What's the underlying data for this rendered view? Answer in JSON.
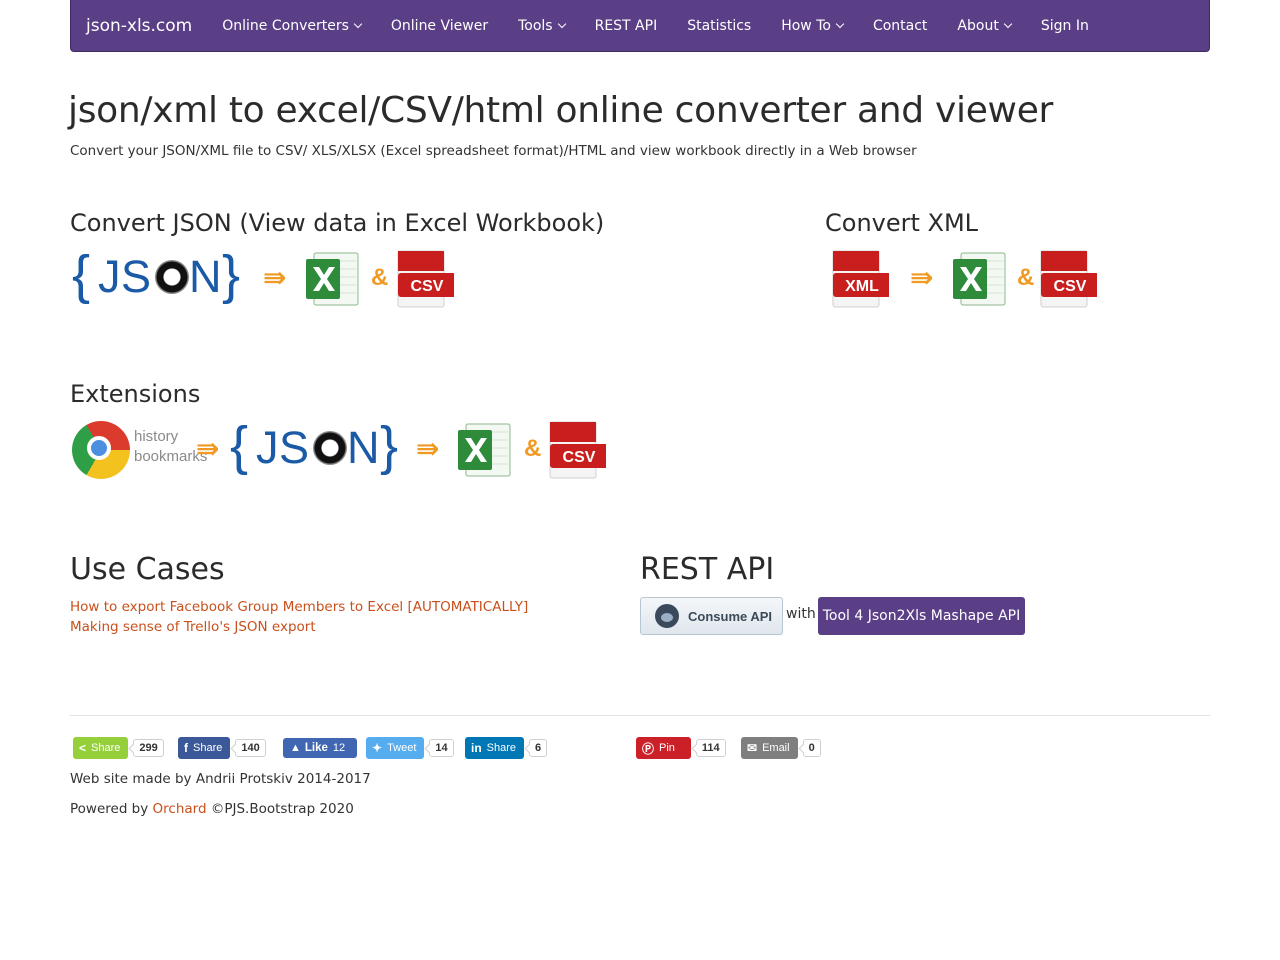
{
  "navbar": {
    "brand": "json-xls.com",
    "items": [
      {
        "label": "Online Converters",
        "dropdown": true
      },
      {
        "label": "Online Viewer",
        "dropdown": false
      },
      {
        "label": "Tools",
        "dropdown": true
      },
      {
        "label": "REST API",
        "dropdown": false
      },
      {
        "label": "Statistics",
        "dropdown": false
      },
      {
        "label": "How To",
        "dropdown": true
      },
      {
        "label": "Contact",
        "dropdown": false
      },
      {
        "label": "About",
        "dropdown": true
      },
      {
        "label": "Sign In",
        "dropdown": false
      }
    ]
  },
  "header": {
    "title": "json/xml to excel/CSV/html online converter and viewer",
    "subtitle": "Convert your JSON/XML file to CSV/ XLS/XLSX (Excel spreadsheet format)/HTML and view workbook directly in a Web browser"
  },
  "sections": {
    "convert_json": "Convert JSON (View data in Excel Workbook)",
    "convert_xml": "Convert XML",
    "extensions": "Extensions",
    "use_cases": "Use Cases",
    "rest_api": "REST API"
  },
  "icons": {
    "json_open_brace": "{",
    "json_close_brace": "}",
    "json_left": "JS",
    "json_right": "N",
    "arrow": "⇛",
    "ampersand": "&",
    "csv_label": "CSV",
    "xml_label": "XML",
    "chrome_text_line1": "history",
    "chrome_text_line2": "bookmarks",
    "accent_orange": "#f09a23",
    "file_red": "#c81e1e",
    "excel_green": "#2e8b3a"
  },
  "use_cases": {
    "links": [
      "How to export Facebook Group Members to Excel [AUTOMATICALLY]",
      "Making sense of Trello's JSON export"
    ]
  },
  "rest_api": {
    "consume_label": "Consume API",
    "with_text": "with",
    "mashape_label": "Tool 4 Json2Xls Mashape API"
  },
  "social": {
    "share_all": {
      "label": "Share",
      "count": "299",
      "color": "#95d03a"
    },
    "facebook_share": {
      "label": "Share",
      "count": "140",
      "color": "#3b5998"
    },
    "facebook_like": {
      "label": "Like",
      "count": "12",
      "color": "#4267b2"
    },
    "twitter": {
      "label": "Tweet",
      "count": "14",
      "color": "#55acee"
    },
    "linkedin": {
      "label": "Share",
      "count": "6",
      "color": "#0077b5"
    },
    "pinterest": {
      "label": "Pin",
      "count": "114",
      "color": "#cb2027"
    },
    "email": {
      "label": "Email",
      "count": "0",
      "color": "#7f7f7f"
    }
  },
  "footer": {
    "made_by": "Web site made by Andrii Protskiv 2014-2017",
    "powered_prefix": "Powered by",
    "powered_link": "Orchard",
    "powered_suffix": "©PJS.Bootstrap 2020"
  }
}
